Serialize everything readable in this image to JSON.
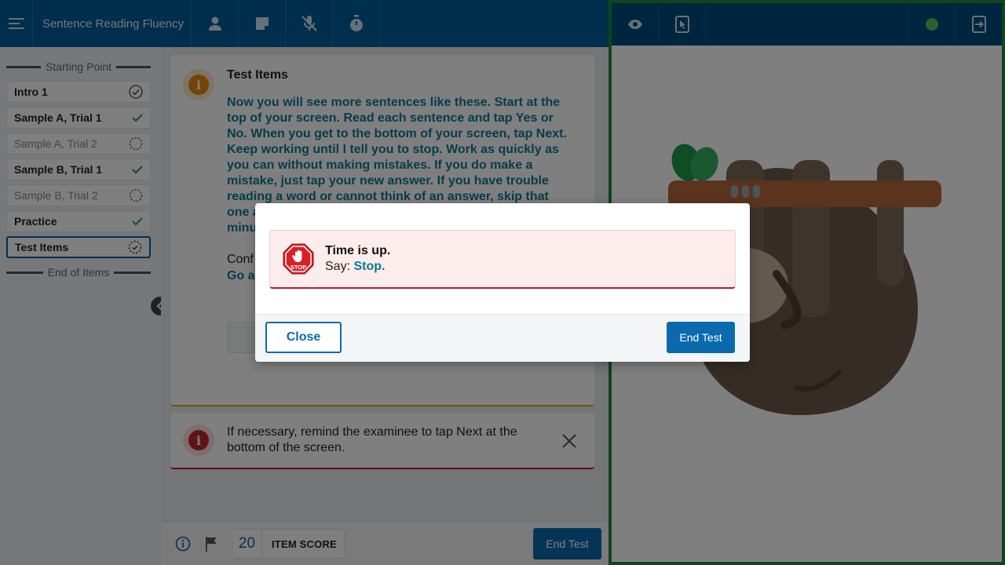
{
  "app": {
    "title": "Sentence Reading Fluency",
    "toolbar_icons": [
      "menu-icon",
      "person-icon",
      "note-icon",
      "mic-off-icon",
      "timer-icon"
    ]
  },
  "sidebar": {
    "start_label": "Starting Point",
    "end_label": "End of Items",
    "items": [
      {
        "label": "Intro 1",
        "status": "check-circle-icon"
      },
      {
        "label": "Sample A, Trial 1",
        "status": "check-icon"
      },
      {
        "label": "Sample A, Trial 2",
        "status": "dashed-circle-icon"
      },
      {
        "label": "Sample B, Trial 1",
        "status": "check-icon"
      },
      {
        "label": "Sample B, Trial 2",
        "status": "dashed-circle-icon"
      },
      {
        "label": "Practice",
        "status": "check-icon"
      },
      {
        "label": "Test Items",
        "status": "timer-circle-icon"
      }
    ]
  },
  "card": {
    "title": "Test Items",
    "lines": [
      "Now you will see more sentences like these. Start at the",
      "top of your screen. Read each sentence and tap Yes or",
      "No. When you get to the bottom of your screen, tap Next.",
      "Keep working until I tell you to stop. Work as quickly as",
      "you can without making mistakes. If you do make a",
      "mistake, just tap your new answer. If you have trouble",
      "reading a word or cannot think of an answer, skip that",
      "one a",
      "minu"
    ],
    "confirm_text": "Conf",
    "goa_text": "Go a"
  },
  "reminder": {
    "text": "If necessary, remind the examinee to tap Next at the bottom of the screen."
  },
  "footer": {
    "score": "20",
    "score_label": "ITEM SCORE",
    "end_test_label": "End Test"
  },
  "modal": {
    "title": "Time is up.",
    "say_prefix": "Say:",
    "say_value": "Stop.",
    "stop_sign_text": "STOP",
    "close_label": "Close",
    "end_test_label": "End Test"
  },
  "colors": {
    "primary": "#0b6aad",
    "header": "#005d9a",
    "teal_text": "#0a7a96",
    "success": "#1e8a3a",
    "warning": "#e8890d",
    "danger": "#c0262d"
  }
}
